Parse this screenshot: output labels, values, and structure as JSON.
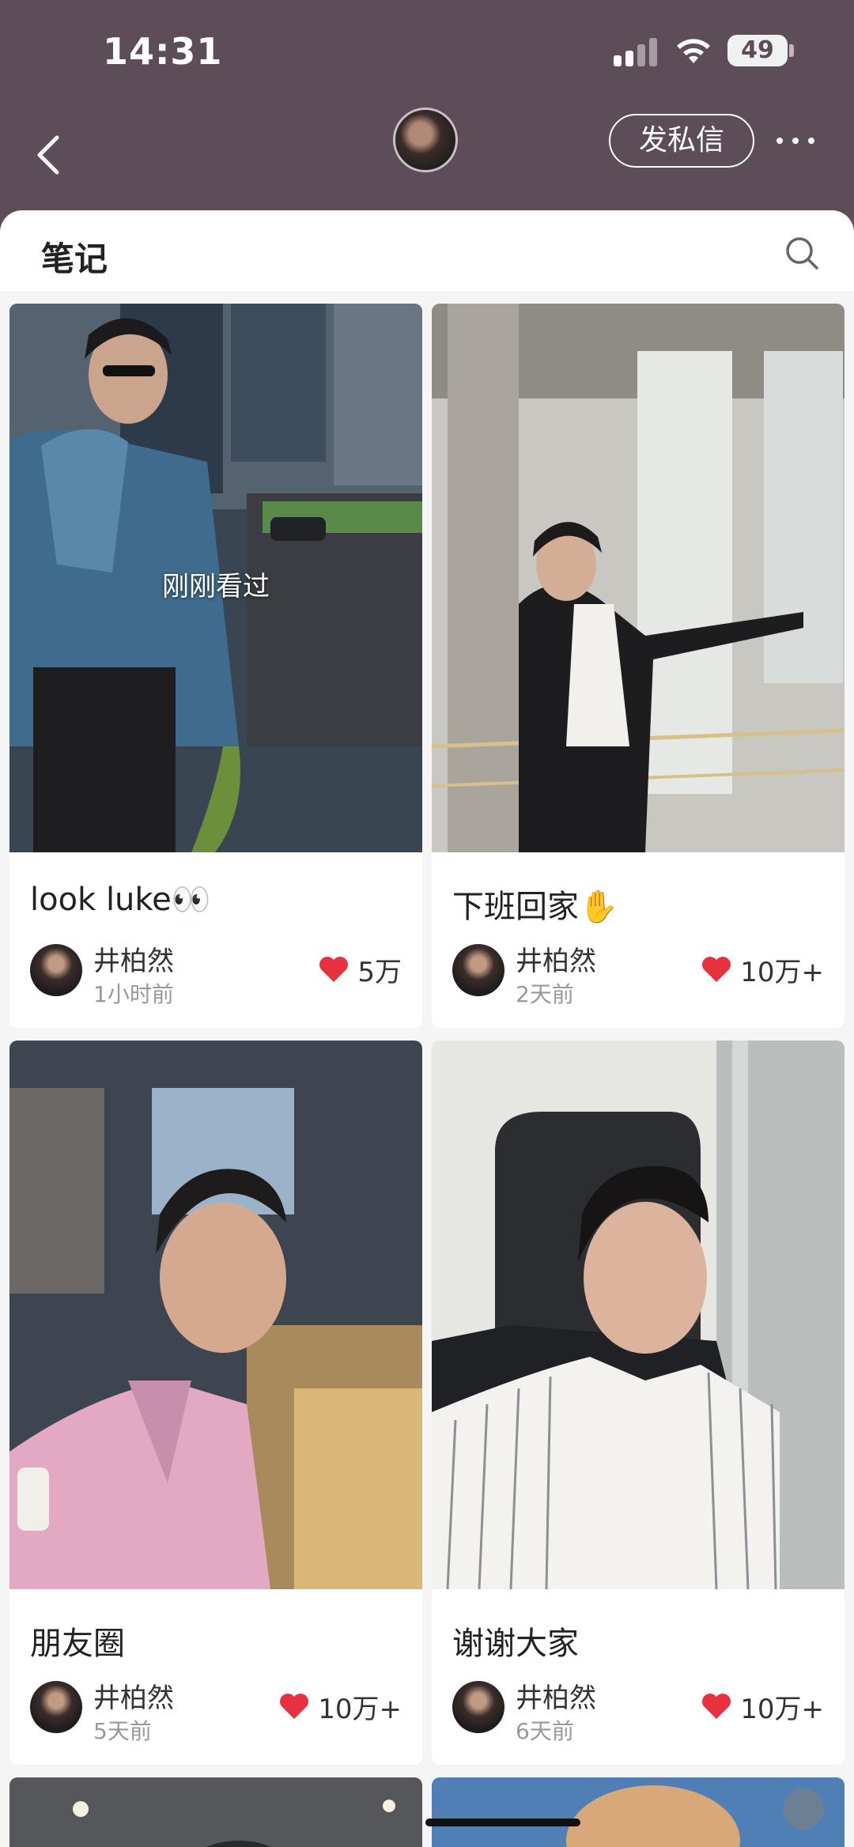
{
  "status_bar": {
    "time": "14:31",
    "battery": "49"
  },
  "nav": {
    "dm_label": "发私信"
  },
  "section": {
    "title": "笔记"
  },
  "cards": [
    {
      "title": "look luke👀",
      "author": "井柏然",
      "time": "1小时前",
      "likes": "5万",
      "overlay": "刚刚看过"
    },
    {
      "title": "下班回家✋",
      "author": "井柏然",
      "time": "2天前",
      "likes": "10万+"
    },
    {
      "title": "朋友圈",
      "author": "井柏然",
      "time": "5天前",
      "likes": "10万+"
    },
    {
      "title": "谢谢大家",
      "author": "井柏然",
      "time": "6天前",
      "likes": "10万+"
    }
  ],
  "colors": {
    "header_bg": "#5d4d59",
    "heart": "#e8313f",
    "page_bg": "#f5f5f5"
  }
}
